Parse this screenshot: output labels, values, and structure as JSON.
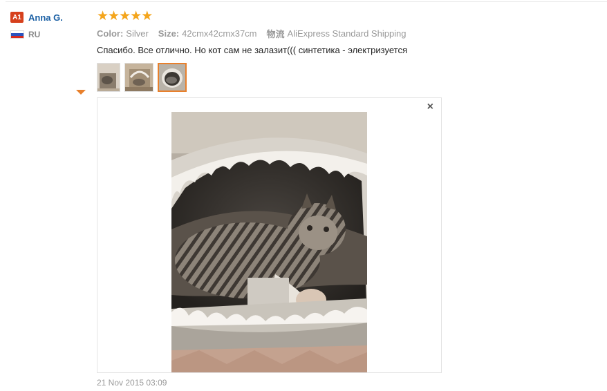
{
  "reviewer": {
    "level_badge": "A1",
    "name": "Anna G.",
    "country_code": "RU",
    "flag_colors": [
      "#ffffff",
      "#2a52be",
      "#d52b1e"
    ]
  },
  "review": {
    "rating": 5,
    "rating_max": 5,
    "star_glyph": "★",
    "star_color": "#f4a51c",
    "attributes": [
      {
        "label": "Color:",
        "value": "Silver"
      },
      {
        "label": "Size:",
        "value": "42cmx42cmx37cm"
      },
      {
        "label": "物流",
        "value": "AliExpress Standard Shipping"
      }
    ],
    "text": "Спасибо. Все отлично. Но кот сам не залазит((( синтетика - электризуется",
    "thumbnails": [
      {
        "name": "photo-thumbnail-1",
        "active": false
      },
      {
        "name": "photo-thumbnail-2",
        "active": false
      },
      {
        "name": "photo-thumbnail-3",
        "active": true
      }
    ],
    "viewer_close": "×",
    "date": "21 Nov 2015 03:09"
  },
  "colors": {
    "accent": "#e8802c",
    "name_link": "#1a5fa4",
    "badge": "#d6401c"
  }
}
